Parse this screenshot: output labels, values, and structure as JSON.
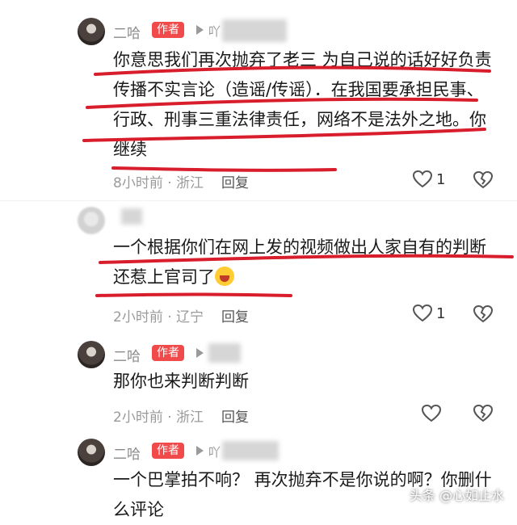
{
  "comments": [
    {
      "name": "二哈",
      "badge": "作者",
      "reply_to": "吖",
      "text": "你意思我们再次抛弃了老三 为自己说的话好好负责  传播不实言论（造谣/传谣）．在我国要承担民事、行政、刑事三重法律责任，网络不是法外之地。你继续",
      "time": "8小时前 · 浙江",
      "reply_label": "回复",
      "likes": "1"
    },
    {
      "name": "",
      "badge": "",
      "reply_to": "",
      "text": "一个根据你们在网上发的视频做出人家自有的判断还惹上官司了",
      "time": "2小时前 · 辽宁",
      "reply_label": "回复",
      "likes": "1"
    },
    {
      "name": "二哈",
      "badge": "作者",
      "reply_to": "",
      "text": "那你也来判断判断",
      "time": "2小时前 · 浙江",
      "reply_label": "回复",
      "likes": ""
    },
    {
      "name": "二哈",
      "badge": "作者",
      "reply_to": "吖",
      "text": "一个巴掌拍不响？ 再次抛弃不是你说的啊？你删什么评论",
      "time": "",
      "reply_label": "",
      "likes": ""
    }
  ],
  "icons": {
    "like": "heart-outline-icon",
    "dislike": "broken-heart-icon",
    "emoji": "laughing-crying-emoji"
  },
  "watermark": "头条 @心如止水",
  "colors": {
    "badge": "#f04a4a",
    "underline": "#d81e2c",
    "meta_text": "#9a9a9a"
  }
}
